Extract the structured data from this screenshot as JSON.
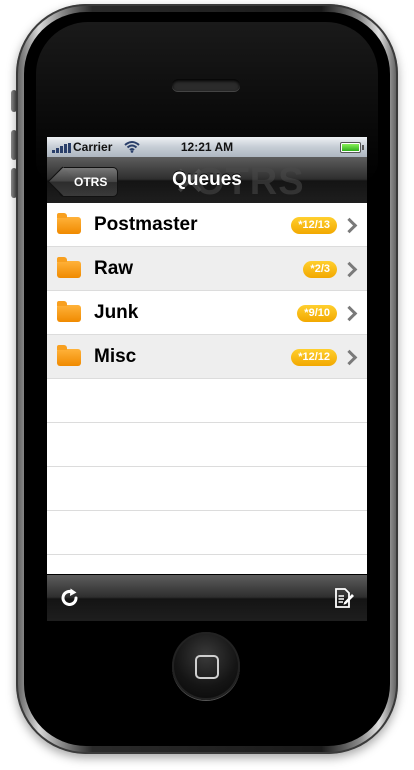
{
  "status_bar": {
    "carrier": "Carrier",
    "time": "12:21 AM",
    "battery_level": 1.0
  },
  "nav_bar": {
    "back_label": "OTRS",
    "title": "Queues",
    "watermark": "OTRS"
  },
  "queues": [
    {
      "name": "Postmaster",
      "count": "*12/13"
    },
    {
      "name": "Raw",
      "count": "*2/3"
    },
    {
      "name": "Junk",
      "count": "*9/10"
    },
    {
      "name": "Misc",
      "count": "*12/12"
    }
  ],
  "toolbar": {
    "left_icon": "refresh-icon",
    "right_icon": "compose-icon"
  },
  "colors": {
    "badge": "#f7b500",
    "folder": "#f79a10",
    "bar": "#1e1e1e"
  }
}
